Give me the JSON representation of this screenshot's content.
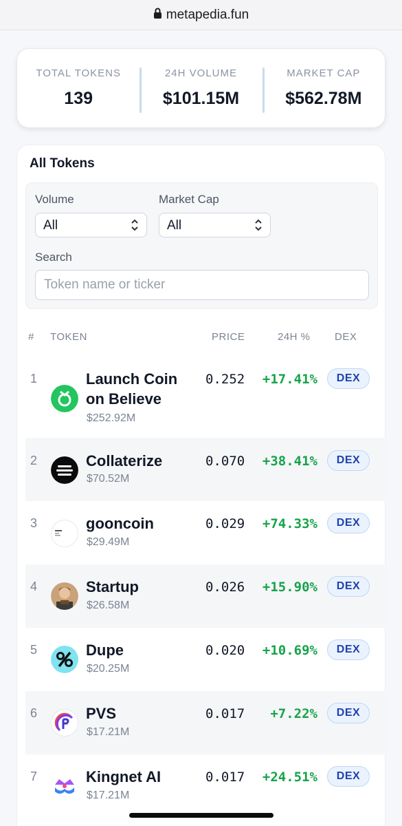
{
  "browser": {
    "url": "metapedia.fun"
  },
  "stats": [
    {
      "label": "TOTAL TOKENS",
      "value": "139"
    },
    {
      "label": "24H VOLUME",
      "value": "$101.15M"
    },
    {
      "label": "MARKET CAP",
      "value": "$562.78M"
    }
  ],
  "panel": {
    "title": "All Tokens",
    "filters": {
      "volume_label": "Volume",
      "volume_value": "All",
      "marketcap_label": "Market Cap",
      "marketcap_value": "All",
      "search_label": "Search",
      "search_placeholder": "Token name or ticker"
    },
    "columns": [
      "#",
      "TOKEN",
      "PRICE",
      "24H %",
      "DEX"
    ],
    "rows": [
      {
        "rank": "1",
        "name": "Launch Coin on Believe",
        "cap": "$252.92M",
        "price": "0.252",
        "change": "+17.41%",
        "dex": "DEX",
        "icon": "launchcoin-icon"
      },
      {
        "rank": "2",
        "name": "Collaterize",
        "cap": "$70.52M",
        "price": "0.070",
        "change": "+38.41%",
        "dex": "DEX",
        "icon": "collaterize-icon"
      },
      {
        "rank": "3",
        "name": "gooncoin",
        "cap": "$29.49M",
        "price": "0.029",
        "change": "+74.33%",
        "dex": "DEX",
        "icon": "gooncoin-icon"
      },
      {
        "rank": "4",
        "name": "Startup",
        "cap": "$26.58M",
        "price": "0.026",
        "change": "+15.90%",
        "dex": "DEX",
        "icon": "startup-avatar-icon"
      },
      {
        "rank": "5",
        "name": "Dupe",
        "cap": "$20.25M",
        "price": "0.020",
        "change": "+10.69%",
        "dex": "DEX",
        "icon": "dupe-icon"
      },
      {
        "rank": "6",
        "name": "PVS",
        "cap": "$17.21M",
        "price": "0.017",
        "change": "+7.22%",
        "dex": "DEX",
        "icon": "pvs-icon"
      },
      {
        "rank": "7",
        "name": "Kingnet AI",
        "cap": "$17.21M",
        "price": "0.017",
        "change": "+24.51%",
        "dex": "DEX",
        "icon": "kingnet-icon"
      }
    ]
  },
  "colors": {
    "positive": "#16a34a",
    "dex_text": "#1e40af",
    "dex_bg": "#eaf3fd"
  }
}
